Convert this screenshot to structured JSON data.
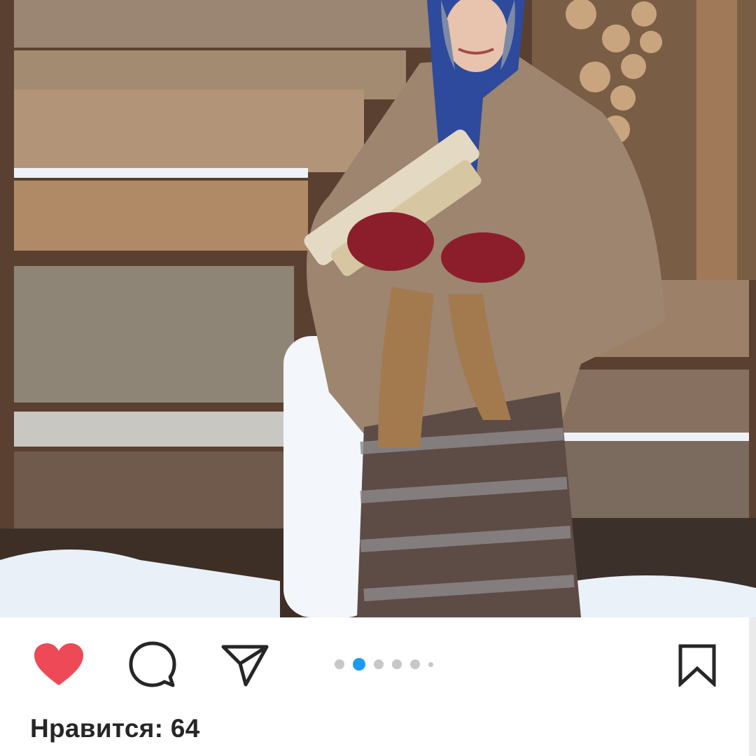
{
  "post": {
    "image_description": "",
    "carousel": {
      "count": 6,
      "active_index": 1
    }
  },
  "actions": {
    "like": "heart-icon",
    "comment": "comment-bubble-icon",
    "share": "paper-plane-icon",
    "save": "bookmark-icon"
  },
  "likes": {
    "text": "Нравится: 64"
  },
  "colors": {
    "heart": "#ed4956",
    "active_dot": "#1d9bf0",
    "inactive_dot": "#c7c7c7",
    "text": "#262626"
  }
}
